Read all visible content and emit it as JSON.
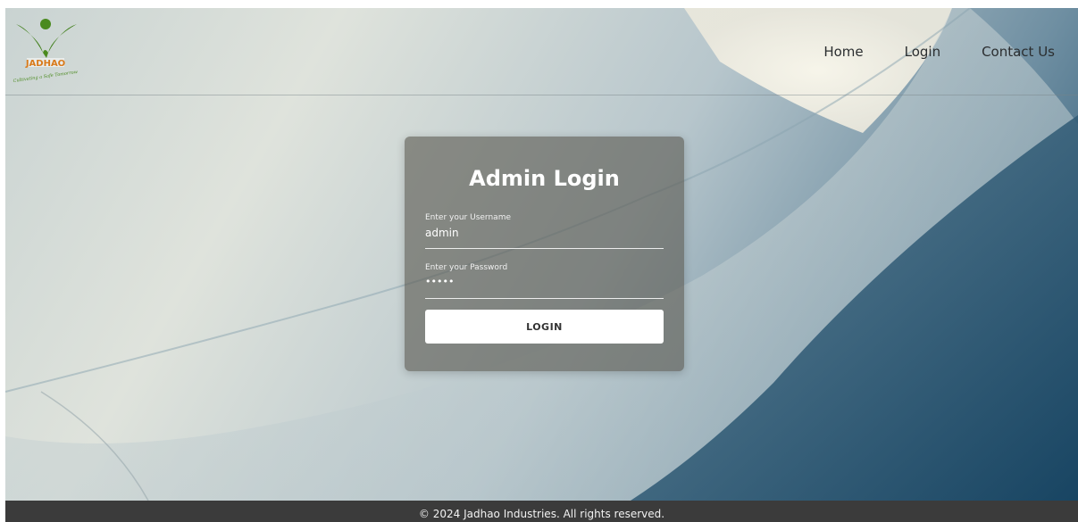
{
  "brand": {
    "logo_text": "JADHAO",
    "tagline": "Cultivating a Safe Tomorrow"
  },
  "nav": {
    "items": [
      {
        "label": "Home"
      },
      {
        "label": "Login"
      },
      {
        "label": "Contact Us"
      }
    ]
  },
  "login": {
    "title": "Admin Login",
    "username_label": "Enter your Username",
    "username_value": "admin",
    "password_label": "Enter your Password",
    "password_value": "•••••",
    "button_label": "LOGIN"
  },
  "footer": {
    "text": "© 2024 Jadhao Industries. All rights reserved."
  },
  "colors": {
    "footer_bg": "#3b3b3b",
    "card_bg": "rgba(90,88,80,0.62)",
    "logo_green": "#4a8a1e",
    "logo_orange": "#d97a1a"
  }
}
